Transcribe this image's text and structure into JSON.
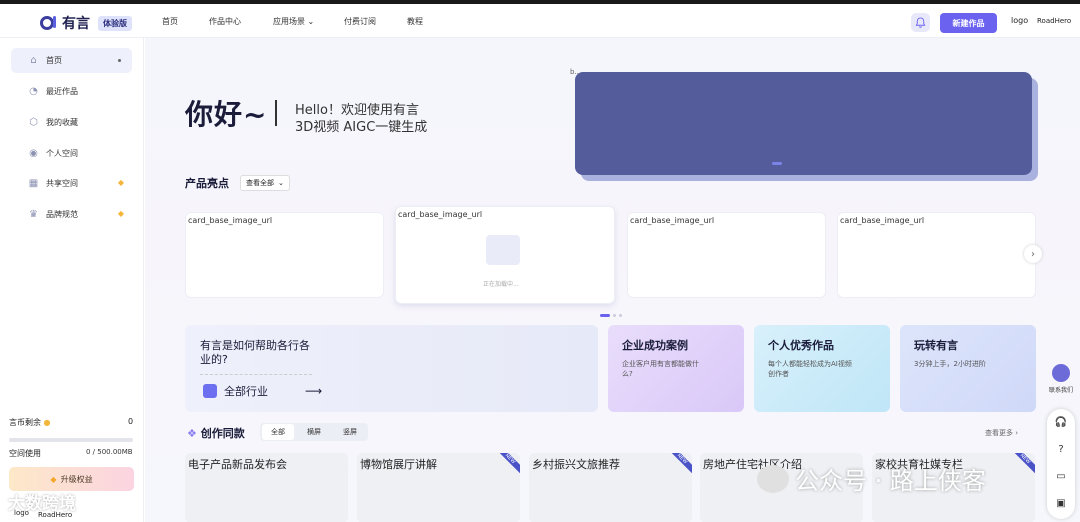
{
  "header": {
    "logo_text": "有言",
    "badge": "体验版",
    "nav": [
      "首页",
      "作品中心",
      "应用场景",
      "付费订阅",
      "教程"
    ],
    "new_button": "新建作品",
    "logo_placeholder": "logo",
    "username": "RoadHero"
  },
  "sidebar": {
    "items": [
      {
        "label": "首页",
        "icon": "home-icon"
      },
      {
        "label": "最近作品",
        "icon": "clock-icon"
      },
      {
        "label": "我的收藏",
        "icon": "bookmark-icon"
      },
      {
        "label": "个人空间",
        "icon": "user-icon"
      },
      {
        "label": "共享空间",
        "icon": "grid-icon"
      },
      {
        "label": "品牌规范",
        "icon": "crown-icon"
      }
    ],
    "coin_label": "言币剩余",
    "coin_value": "0",
    "space_label": "空间使用",
    "space_value": "0 / 500.00MB",
    "space_used_fraction": 0,
    "upgrade": "升级权益",
    "logo_placeholder": "logo",
    "username": "RoadHero"
  },
  "hero": {
    "greeting": "你好~",
    "line1": "Hello！欢迎使用有言",
    "line2": "3D视频 AIGC一键生成",
    "banner_label": "b..."
  },
  "highlights": {
    "title": "产品亮点",
    "dropdown": "查看全部",
    "cards": [
      "card_base_image_url",
      "card_base_image_url",
      "card_base_image_url",
      "card_base_image_url"
    ],
    "loading": "正在加载中..."
  },
  "help": {
    "title": "有言是如何帮助各行各业的?",
    "all_industries": "全部行业"
  },
  "features": [
    {
      "title": "企业成功案例",
      "desc": "企业客户用有言都能做什么?"
    },
    {
      "title": "个人优秀作品",
      "desc": "每个人都能轻松成为AI视频创作者"
    },
    {
      "title": "玩转有言",
      "desc": "3分钟上手，2小时进阶"
    }
  ],
  "create": {
    "title": "创作同款",
    "tabs": [
      "全部",
      "横屏",
      "竖屏"
    ],
    "view_more": "查看更多",
    "templates": [
      "电子产品新品发布会",
      "博物馆展厅讲解",
      "乡村振兴文旅推荐",
      "房地产住宅社区介绍",
      "家校共育社媒专栏"
    ],
    "new_ribbon": "NEW"
  },
  "float": {
    "contact": "联系我们"
  },
  "watermarks": {
    "left": "大数跨境",
    "right": "公众号 · 路上侠客"
  }
}
